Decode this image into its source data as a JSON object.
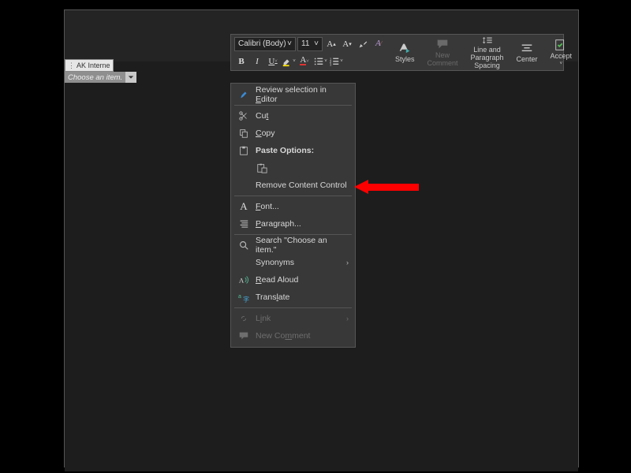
{
  "colors": {
    "accent": "#fe0000"
  },
  "content_control": {
    "tag": "AK Interne",
    "placeholder": "Choose an item."
  },
  "mini_toolbar": {
    "font_name": "Calibri (Body)",
    "font_size": "11",
    "styles_label": "Styles",
    "new_comment_label": "New Comment",
    "spacing_label": "Line and Paragraph Spacing",
    "center_label": "Center",
    "accept_label": "Accept"
  },
  "context_menu": {
    "review": "Review selection in Editor",
    "cut": "Cut",
    "copy": "Copy",
    "paste_options": "Paste Options:",
    "remove_cc": "Remove Content Control",
    "font": "Font...",
    "paragraph": "Paragraph...",
    "search": "Search \"Choose an item.\"",
    "synonyms": "Synonyms",
    "read_aloud": "Read Aloud",
    "translate": "Translate",
    "link": "Link",
    "new_comment": "New Comment",
    "accel": {
      "review": "E",
      "cut": "t",
      "copy": "C",
      "font": "F",
      "paragraph": "P",
      "read": "R",
      "translate": "l",
      "link": "i",
      "newc": "M"
    }
  }
}
